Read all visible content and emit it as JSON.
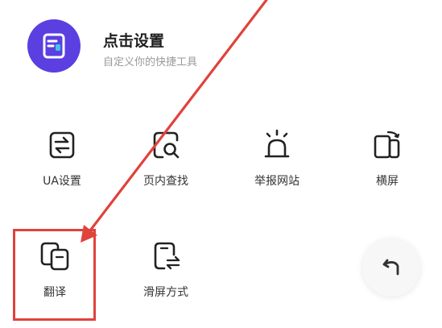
{
  "header": {
    "title": "点击设置",
    "subtitle": "自定义你的快捷工具",
    "icon": "settings-card-icon",
    "accent": "#5b3fe0"
  },
  "tools": [
    {
      "label": "UA设置",
      "icon": "ua-switch-icon"
    },
    {
      "label": "页内查找",
      "icon": "page-search-icon"
    },
    {
      "label": "举报网站",
      "icon": "alarm-report-icon"
    },
    {
      "label": "横屏",
      "icon": "rotate-screen-icon"
    },
    {
      "label": "翻译",
      "icon": "translate-icon"
    },
    {
      "label": "滑屏方式",
      "icon": "swipe-mode-icon"
    }
  ],
  "back_button": {
    "icon": "back-arrow-icon"
  },
  "annotation": {
    "color": "#e0423c"
  }
}
